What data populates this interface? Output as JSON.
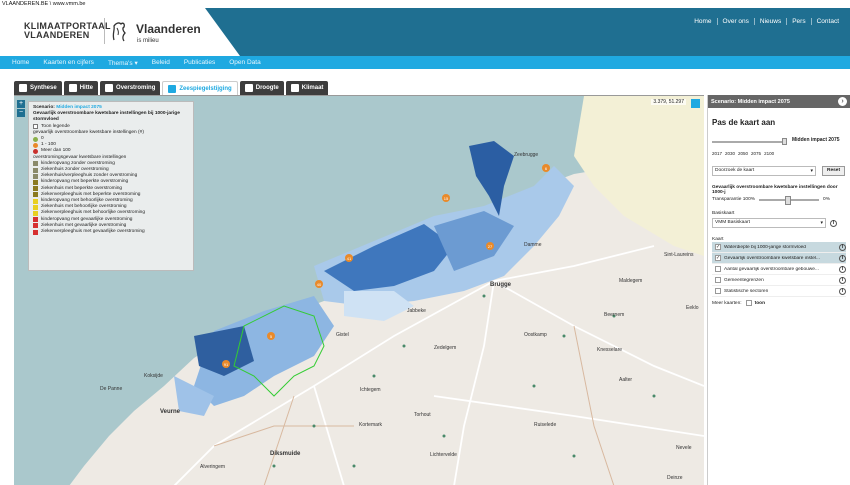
{
  "browser": {
    "url": "VLAANDEREN.BE \\ www.vmm.be"
  },
  "header": {
    "logo_line1": "KLIMAATPORTAAL",
    "logo_line2": "VLAANDEREN",
    "brand": "Vlaanderen",
    "brand_sub": "is milieu",
    "top_nav": [
      "Home",
      "Over ons",
      "Nieuws",
      "Pers",
      "Contact"
    ]
  },
  "main_nav": [
    "Home",
    "Kaarten en cijfers",
    "Thema's ▾",
    "Beleid",
    "Publicaties",
    "Open Data"
  ],
  "tabs": [
    {
      "label": "Synthese",
      "active": false
    },
    {
      "label": "Hitte",
      "active": false
    },
    {
      "label": "Overstroming",
      "active": false
    },
    {
      "label": "Zeespiegelstijging",
      "active": true
    },
    {
      "label": "Droogte",
      "active": false
    },
    {
      "label": "Klimaat",
      "active": false
    }
  ],
  "map": {
    "coordinates": "3.379, 51.297",
    "legend": {
      "scenario_label": "Scenario:",
      "scenario_value": "Midden impact 2075",
      "layer_title": "Gevaarlijk overstroombare kwetsbare instellingen bij 1000-jarige stormvloed",
      "toggle_label": "Toon legende",
      "group1_title": "gevaarlijk overstroombare kwetsbare instellingen (#)",
      "classes": [
        {
          "label": "0",
          "color": "#8ab04a"
        },
        {
          "label": "1 - 100",
          "color": "#e98a2a"
        },
        {
          "label": "Meer dan 100",
          "color": "#c9302c"
        }
      ],
      "group2_title": "overstromingsgevaar kwetsbare instellingen",
      "items": [
        {
          "label": "kinderopvang zonder overstroming",
          "color": "#8a8a6a"
        },
        {
          "label": "ziekenhuis zonder overstroming",
          "color": "#8a8a6a"
        },
        {
          "label": "ziekenhuis/verpleeghuis zonder overstroming",
          "color": "#8a8a6a"
        },
        {
          "label": "kinderopvang met beperkte overstroming",
          "color": "#8a7a20"
        },
        {
          "label": "ziekenhuis met beperkte overstroming",
          "color": "#8a7a20"
        },
        {
          "label": "ziekenverpleeghuis met beperkte overstroming",
          "color": "#8a7a20"
        },
        {
          "label": "kinderopvang met behoorlijke overstroming",
          "color": "#e8d020"
        },
        {
          "label": "ziekenhuis met behoorlijke overstroming",
          "color": "#e8d020"
        },
        {
          "label": "ziekenverpleeghuis met behoorlijke overstroming",
          "color": "#e8d020"
        },
        {
          "label": "kinderopvang met gevaarlijke overstroming",
          "color": "#d63030"
        },
        {
          "label": "ziekenhuis met gevaarlijke overstroming",
          "color": "#d63030"
        },
        {
          "label": "ziekenverpleeghuis met gevaarlijke overstroming",
          "color": "#d63030"
        }
      ]
    },
    "cluster_labels": [
      "6",
      "15",
      "27",
      "41",
      "40",
      "5",
      "91"
    ],
    "place_names": [
      "Brugge",
      "Zeebrugge",
      "Sint-Laureins",
      "Maldegem",
      "Eeklo",
      "Gistel",
      "Jabbeke",
      "Zedelgem",
      "Oostkamp",
      "Beernem",
      "Knesselare",
      "Aalter",
      "Torhout",
      "Ichtegem",
      "Kortemark",
      "Diksmuide",
      "Veurne",
      "De Panne",
      "Koksijde",
      "Lichtervelde",
      "Ruiselede",
      "Nevele",
      "Deinze",
      "Alveringem",
      "Damme"
    ]
  },
  "panel": {
    "scenario_label": "Scenario:",
    "scenario_value": "Midden impact 2075",
    "title": "Pas de kaart aan",
    "slider_value": "Midden impact 2075",
    "years": [
      "2017",
      "2030",
      "2050",
      "2075",
      "2100"
    ],
    "search_placeholder": "Doorzoek de kaart",
    "reset_label": "Reset",
    "layer_info": "Gevaarlijk overstroombare kwetsbare instellingen door 1000-j",
    "transparency_label": "Transparantie 100%",
    "transparency_end": "0%",
    "basemap_label": "Basiskaart",
    "basemap_value": "VMM Basiskaart",
    "map_label": "Kaart",
    "layers": [
      {
        "label": "Waterdiepte bij 1000-jarige stormvloed",
        "checked": true
      },
      {
        "label": "Gevaarlijk overstroombare kwetsbare instel...",
        "checked": true
      },
      {
        "label": "Aantal gevaarlijk overstroombare gebouwe...",
        "checked": false
      },
      {
        "label": "Gemeentegrenzen",
        "checked": false
      },
      {
        "label": "Statistische sectoren",
        "checked": false
      }
    ],
    "more_layers_label": "Meer kaarten:",
    "more_layers_toggle": "toon"
  },
  "colors": {
    "header": "#1f6f91",
    "accent": "#1fa9e1",
    "sea": "#aac8cc",
    "land": "#eeeae4",
    "flood_dark": "#1b4f8f",
    "flood_light": "#cfe2f4"
  }
}
